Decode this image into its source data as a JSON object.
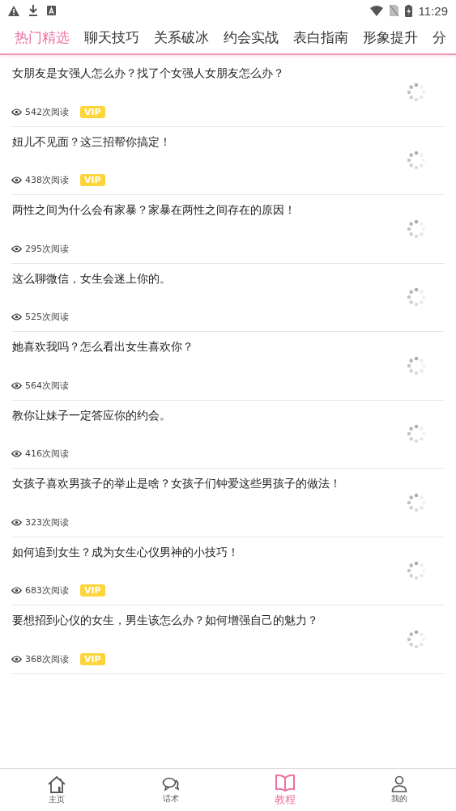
{
  "status_bar": {
    "time": "11:29"
  },
  "tabs": [
    {
      "label": "热门精选",
      "selected": true
    },
    {
      "label": "聊天技巧",
      "selected": false
    },
    {
      "label": "关系破冰",
      "selected": false
    },
    {
      "label": "约会实战",
      "selected": false
    },
    {
      "label": "表白指南",
      "selected": false
    },
    {
      "label": "形象提升",
      "selected": false
    },
    {
      "label": "分",
      "selected": false
    }
  ],
  "articles": [
    {
      "title": "女朋友是女强人怎么办？找了个女强人女朋友怎么办？",
      "reads": "542次阅读",
      "badge": "VIP"
    },
    {
      "title": "妞儿不见面？这三招帮你搞定！",
      "reads": "438次阅读",
      "badge": "VIP"
    },
    {
      "title": "两性之间为什么会有家暴？家暴在两性之间存在的原因！",
      "reads": "295次阅读"
    },
    {
      "title": "这么聊微信，女生会迷上你的。",
      "reads": "525次阅读"
    },
    {
      "title": "她喜欢我吗？怎么看出女生喜欢你？",
      "reads": "564次阅读"
    },
    {
      "title": "教你让妹子一定答应你的约会。",
      "reads": "416次阅读"
    },
    {
      "title": "女孩子喜欢男孩子的举止是啥？女孩子们钟爱这些男孩子的做法！",
      "reads": "323次阅读"
    },
    {
      "title": "如何追到女生？成为女生心仪男神的小技巧！",
      "reads": "683次阅读",
      "badge": "VIP"
    },
    {
      "title": "要想招到心仪的女生，男生该怎么办？如何增强自己的魅力？",
      "reads": "368次阅读",
      "badge": "VIP"
    }
  ],
  "bottom_nav": [
    {
      "label": "主页",
      "kind": "home",
      "selected": false
    },
    {
      "label": "话术",
      "kind": "chat",
      "selected": false
    },
    {
      "label": "教程",
      "kind": "book",
      "selected": true
    },
    {
      "label": "我的",
      "kind": "person",
      "selected": false
    }
  ]
}
